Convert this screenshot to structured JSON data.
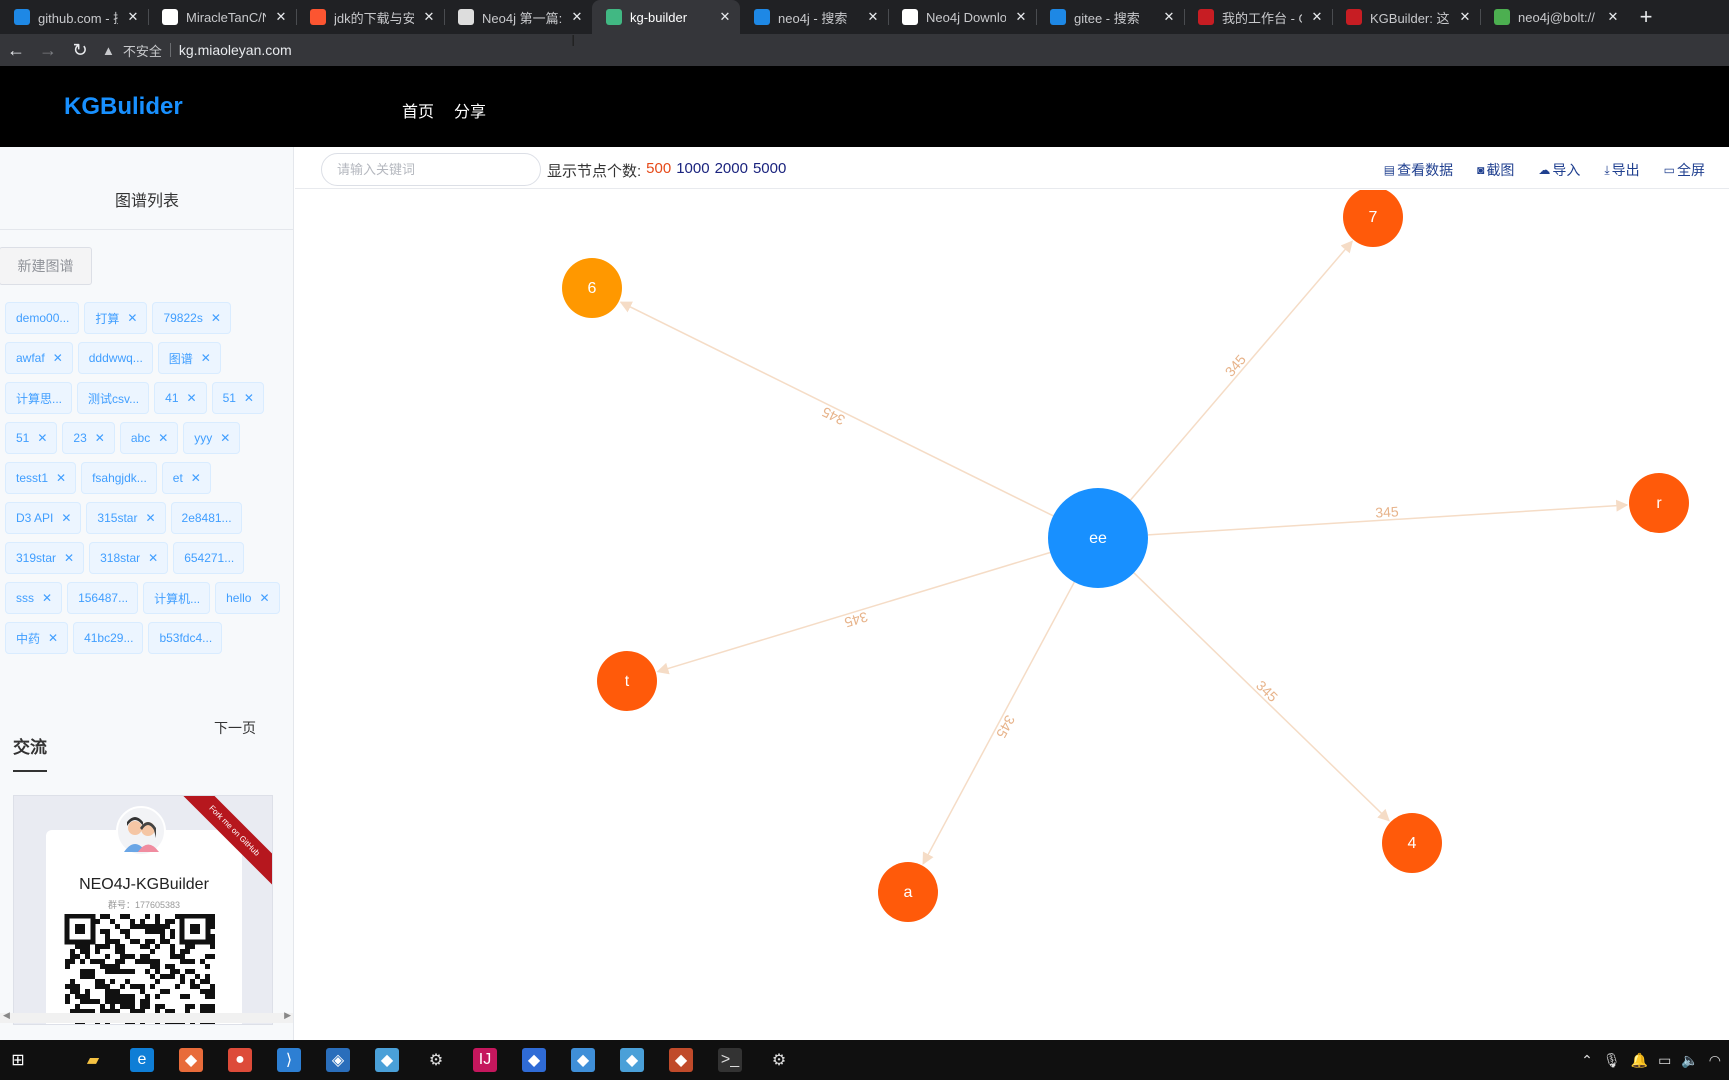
{
  "browser": {
    "tabs": [
      {
        "title": "github.com - 搜",
        "icon": "bing-icon",
        "color": "#1e88e5"
      },
      {
        "title": "MiracleTanC/N",
        "icon": "github-icon",
        "color": "#ffffff"
      },
      {
        "title": "jdk的下载与安装",
        "icon": "csdn-icon",
        "color": "#fc5531"
      },
      {
        "title": "Neo4j 第一篇:",
        "icon": "zhihu-icon",
        "color": "#dddddd"
      },
      {
        "title": "kg-builder",
        "icon": "vue-icon",
        "color": "#41b883",
        "active": true
      },
      {
        "title": "neo4j - 搜索",
        "icon": "bing-icon",
        "color": "#1e88e5"
      },
      {
        "title": "Neo4j Downlo",
        "icon": "neo4j-icon",
        "color": "#ffffff"
      },
      {
        "title": "gitee - 搜索",
        "icon": "bing-icon",
        "color": "#1e88e5"
      },
      {
        "title": "我的工作台 - Gi",
        "icon": "gitee-icon",
        "color": "#c71d23"
      },
      {
        "title": "KGBuilder: 这是",
        "icon": "gitee-icon",
        "color": "#c71d23"
      },
      {
        "title": "neo4j@bolt://",
        "icon": "neo4j-browser-icon",
        "color": "#4caf50"
      }
    ],
    "insecure_label": "不安全",
    "url": "kg.miaoleyan.com"
  },
  "app": {
    "logo": "KGBulider",
    "nav": [
      "首页",
      "分享"
    ]
  },
  "sidebar": {
    "title": "图谱列表",
    "new_button": "新建图谱",
    "tags": [
      {
        "label": "demo00...",
        "closable": false
      },
      {
        "label": "打算",
        "closable": true
      },
      {
        "label": "79822s",
        "closable": true
      },
      {
        "label": "awfaf",
        "closable": true
      },
      {
        "label": "dddwwq...",
        "closable": false
      },
      {
        "label": "图谱",
        "closable": true
      },
      {
        "label": "计算思...",
        "closable": false
      },
      {
        "label": "测试csv...",
        "closable": false
      },
      {
        "label": "41",
        "closable": true
      },
      {
        "label": "51",
        "closable": true
      },
      {
        "label": "51",
        "closable": true
      },
      {
        "label": "23",
        "closable": true
      },
      {
        "label": "abc",
        "closable": true
      },
      {
        "label": "yyy",
        "closable": true
      },
      {
        "label": "tesst1",
        "closable": true
      },
      {
        "label": "fsahgjdk...",
        "closable": false
      },
      {
        "label": "et",
        "closable": true
      },
      {
        "label": "D3 API",
        "closable": true
      },
      {
        "label": "315star",
        "closable": true
      },
      {
        "label": "2e8481...",
        "closable": false
      },
      {
        "label": "319star",
        "closable": true
      },
      {
        "label": "318star",
        "closable": true
      },
      {
        "label": "654271...",
        "closable": false
      },
      {
        "label": "sss",
        "closable": true
      },
      {
        "label": "156487...",
        "closable": false
      },
      {
        "label": "计算机...",
        "closable": false
      },
      {
        "label": "hello",
        "closable": true
      },
      {
        "label": "中药",
        "closable": true
      },
      {
        "label": "41bc29...",
        "closable": false
      },
      {
        "label": "b53fdc4...",
        "closable": false
      }
    ],
    "next_page": "下一页",
    "exchange_title": "交流",
    "card": {
      "name": "NEO4J-KGBuilder",
      "group": "群号：177605383",
      "ribbon": "Fork me on GitHub"
    }
  },
  "toolbar": {
    "search_placeholder": "请输入关键词",
    "count_label": "显示节点个数:",
    "count_options": [
      "500",
      "1000",
      "2000",
      "5000"
    ],
    "count_selected": "500",
    "actions": [
      {
        "label": "查看数据",
        "icon": "document-icon"
      },
      {
        "label": "截图",
        "icon": "camera-icon"
      },
      {
        "label": "导入",
        "icon": "cloud-upload-icon"
      },
      {
        "label": "导出",
        "icon": "download-icon"
      },
      {
        "label": "全屏",
        "icon": "monitor-icon"
      }
    ]
  },
  "graph": {
    "center": {
      "label": "ee",
      "color": "#1890ff"
    },
    "nodes": [
      {
        "label": "6",
        "color": "#ff9800"
      },
      {
        "label": "7",
        "color": "#ff5a0a"
      },
      {
        "label": "r",
        "color": "#ff5a0a"
      },
      {
        "label": "t",
        "color": "#ff5a0a"
      },
      {
        "label": "a",
        "color": "#ff5a0a"
      },
      {
        "label": "4",
        "color": "#ff5a0a"
      }
    ],
    "edge_label": "345",
    "edge_color": "#f5dcc6"
  },
  "taskbar": {
    "apps": [
      "windows-start-icon",
      "file-explorer-icon",
      "edge-icon",
      "app-icon",
      "chrome-icon",
      "vscode-icon",
      "sourcetree-icon",
      "app-icon",
      "settings-icon",
      "intellij-icon",
      "app-icon",
      "app-icon",
      "app-icon",
      "app-icon",
      "terminal-icon",
      "settings-icon"
    ]
  }
}
